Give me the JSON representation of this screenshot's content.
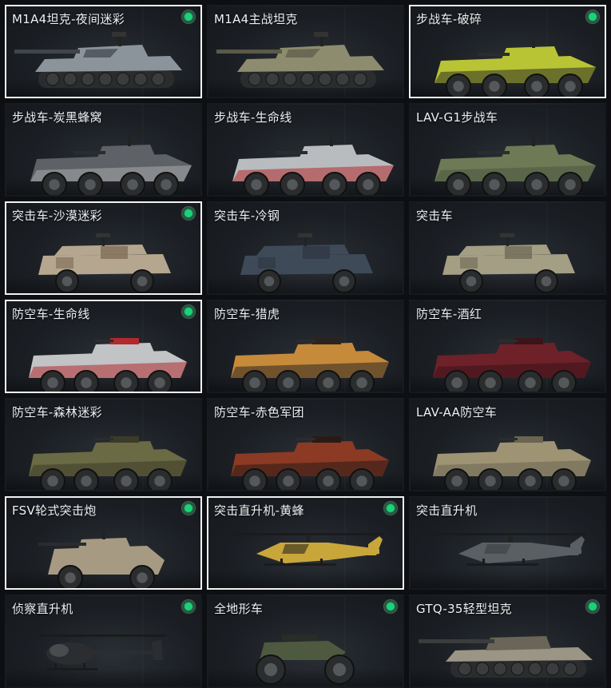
{
  "accent": "#19d37a",
  "selected_border": "#f2f2f2",
  "vehicles": [
    {
      "name": "M1A4坦克-夜间迷彩",
      "type": "tank",
      "selected": true,
      "owned": true,
      "color": "#8c949b",
      "accent": "#3e454c"
    },
    {
      "name": "M1A4主战坦克",
      "type": "tank",
      "selected": false,
      "owned": false,
      "color": "#8e8c6e",
      "accent": "#5b5a48"
    },
    {
      "name": "步战车-破碎",
      "type": "ifv",
      "selected": true,
      "owned": true,
      "color": "#b9c435",
      "accent": "#2b2e20"
    },
    {
      "name": "步战车-炭黑蜂窝",
      "type": "ifv",
      "selected": false,
      "owned": false,
      "color": "#5e6166",
      "accent": "#a9abab"
    },
    {
      "name": "步战车-生命线",
      "type": "ifv",
      "selected": false,
      "owned": false,
      "color": "#b9bcbf",
      "accent": "#b02a2e"
    },
    {
      "name": "LAV-G1步战车",
      "type": "ifv",
      "selected": false,
      "owned": false,
      "color": "#6d7a55",
      "accent": "#4b5640"
    },
    {
      "name": "突击车-沙漠迷彩",
      "type": "mrap",
      "selected": true,
      "owned": true,
      "color": "#b5a68f",
      "accent": "#6f5c47"
    },
    {
      "name": "突击车-冷钢",
      "type": "mrap",
      "selected": false,
      "owned": false,
      "color": "#3f4a58",
      "accent": "#2a323c"
    },
    {
      "name": "突击车",
      "type": "mrap",
      "selected": false,
      "owned": false,
      "color": "#a39e84",
      "accent": "#5f5b4a"
    },
    {
      "name": "防空车-生命线",
      "type": "aa",
      "selected": true,
      "owned": true,
      "color": "#c1c3c5",
      "accent": "#b02a2e"
    },
    {
      "name": "防空车-猎虎",
      "type": "aa",
      "selected": false,
      "owned": false,
      "color": "#c68a3b",
      "accent": "#2a2420"
    },
    {
      "name": "防空车-酒红",
      "type": "aa",
      "selected": false,
      "owned": false,
      "color": "#6e2128",
      "accent": "#3a1418"
    },
    {
      "name": "防空车-森林迷彩",
      "type": "aa",
      "selected": false,
      "owned": false,
      "color": "#6a6a45",
      "accent": "#3c3a28"
    },
    {
      "name": "防空车-赤色军团",
      "type": "aa",
      "selected": false,
      "owned": false,
      "color": "#8c3a24",
      "accent": "#2a1a16"
    },
    {
      "name": "LAV-AA防空车",
      "type": "aa",
      "selected": false,
      "owned": false,
      "color": "#9e9474",
      "accent": "#6a6450"
    },
    {
      "name": "FSV轮式突击炮",
      "type": "fsv",
      "selected": true,
      "owned": true,
      "color": "#a69a82",
      "accent": "#5d5446"
    },
    {
      "name": "突击直升机-黄蜂",
      "type": "heli",
      "selected": true,
      "owned": true,
      "color": "#c9a63a",
      "accent": "#2a2822"
    },
    {
      "name": "突击直升机",
      "type": "heli",
      "selected": false,
      "owned": false,
      "color": "#5a5f64",
      "accent": "#3a3e42"
    },
    {
      "name": "侦察直升机",
      "type": "scout",
      "selected": false,
      "owned": true,
      "color": "#2b2d30",
      "accent": "#505458"
    },
    {
      "name": "全地形车",
      "type": "atv",
      "selected": false,
      "owned": true,
      "color": "#4e5a40",
      "accent": "#2a2c28"
    },
    {
      "name": "GTQ-35轻型坦克",
      "type": "ltank",
      "selected": false,
      "owned": true,
      "color": "#9b9585",
      "accent": "#6a6558"
    }
  ]
}
